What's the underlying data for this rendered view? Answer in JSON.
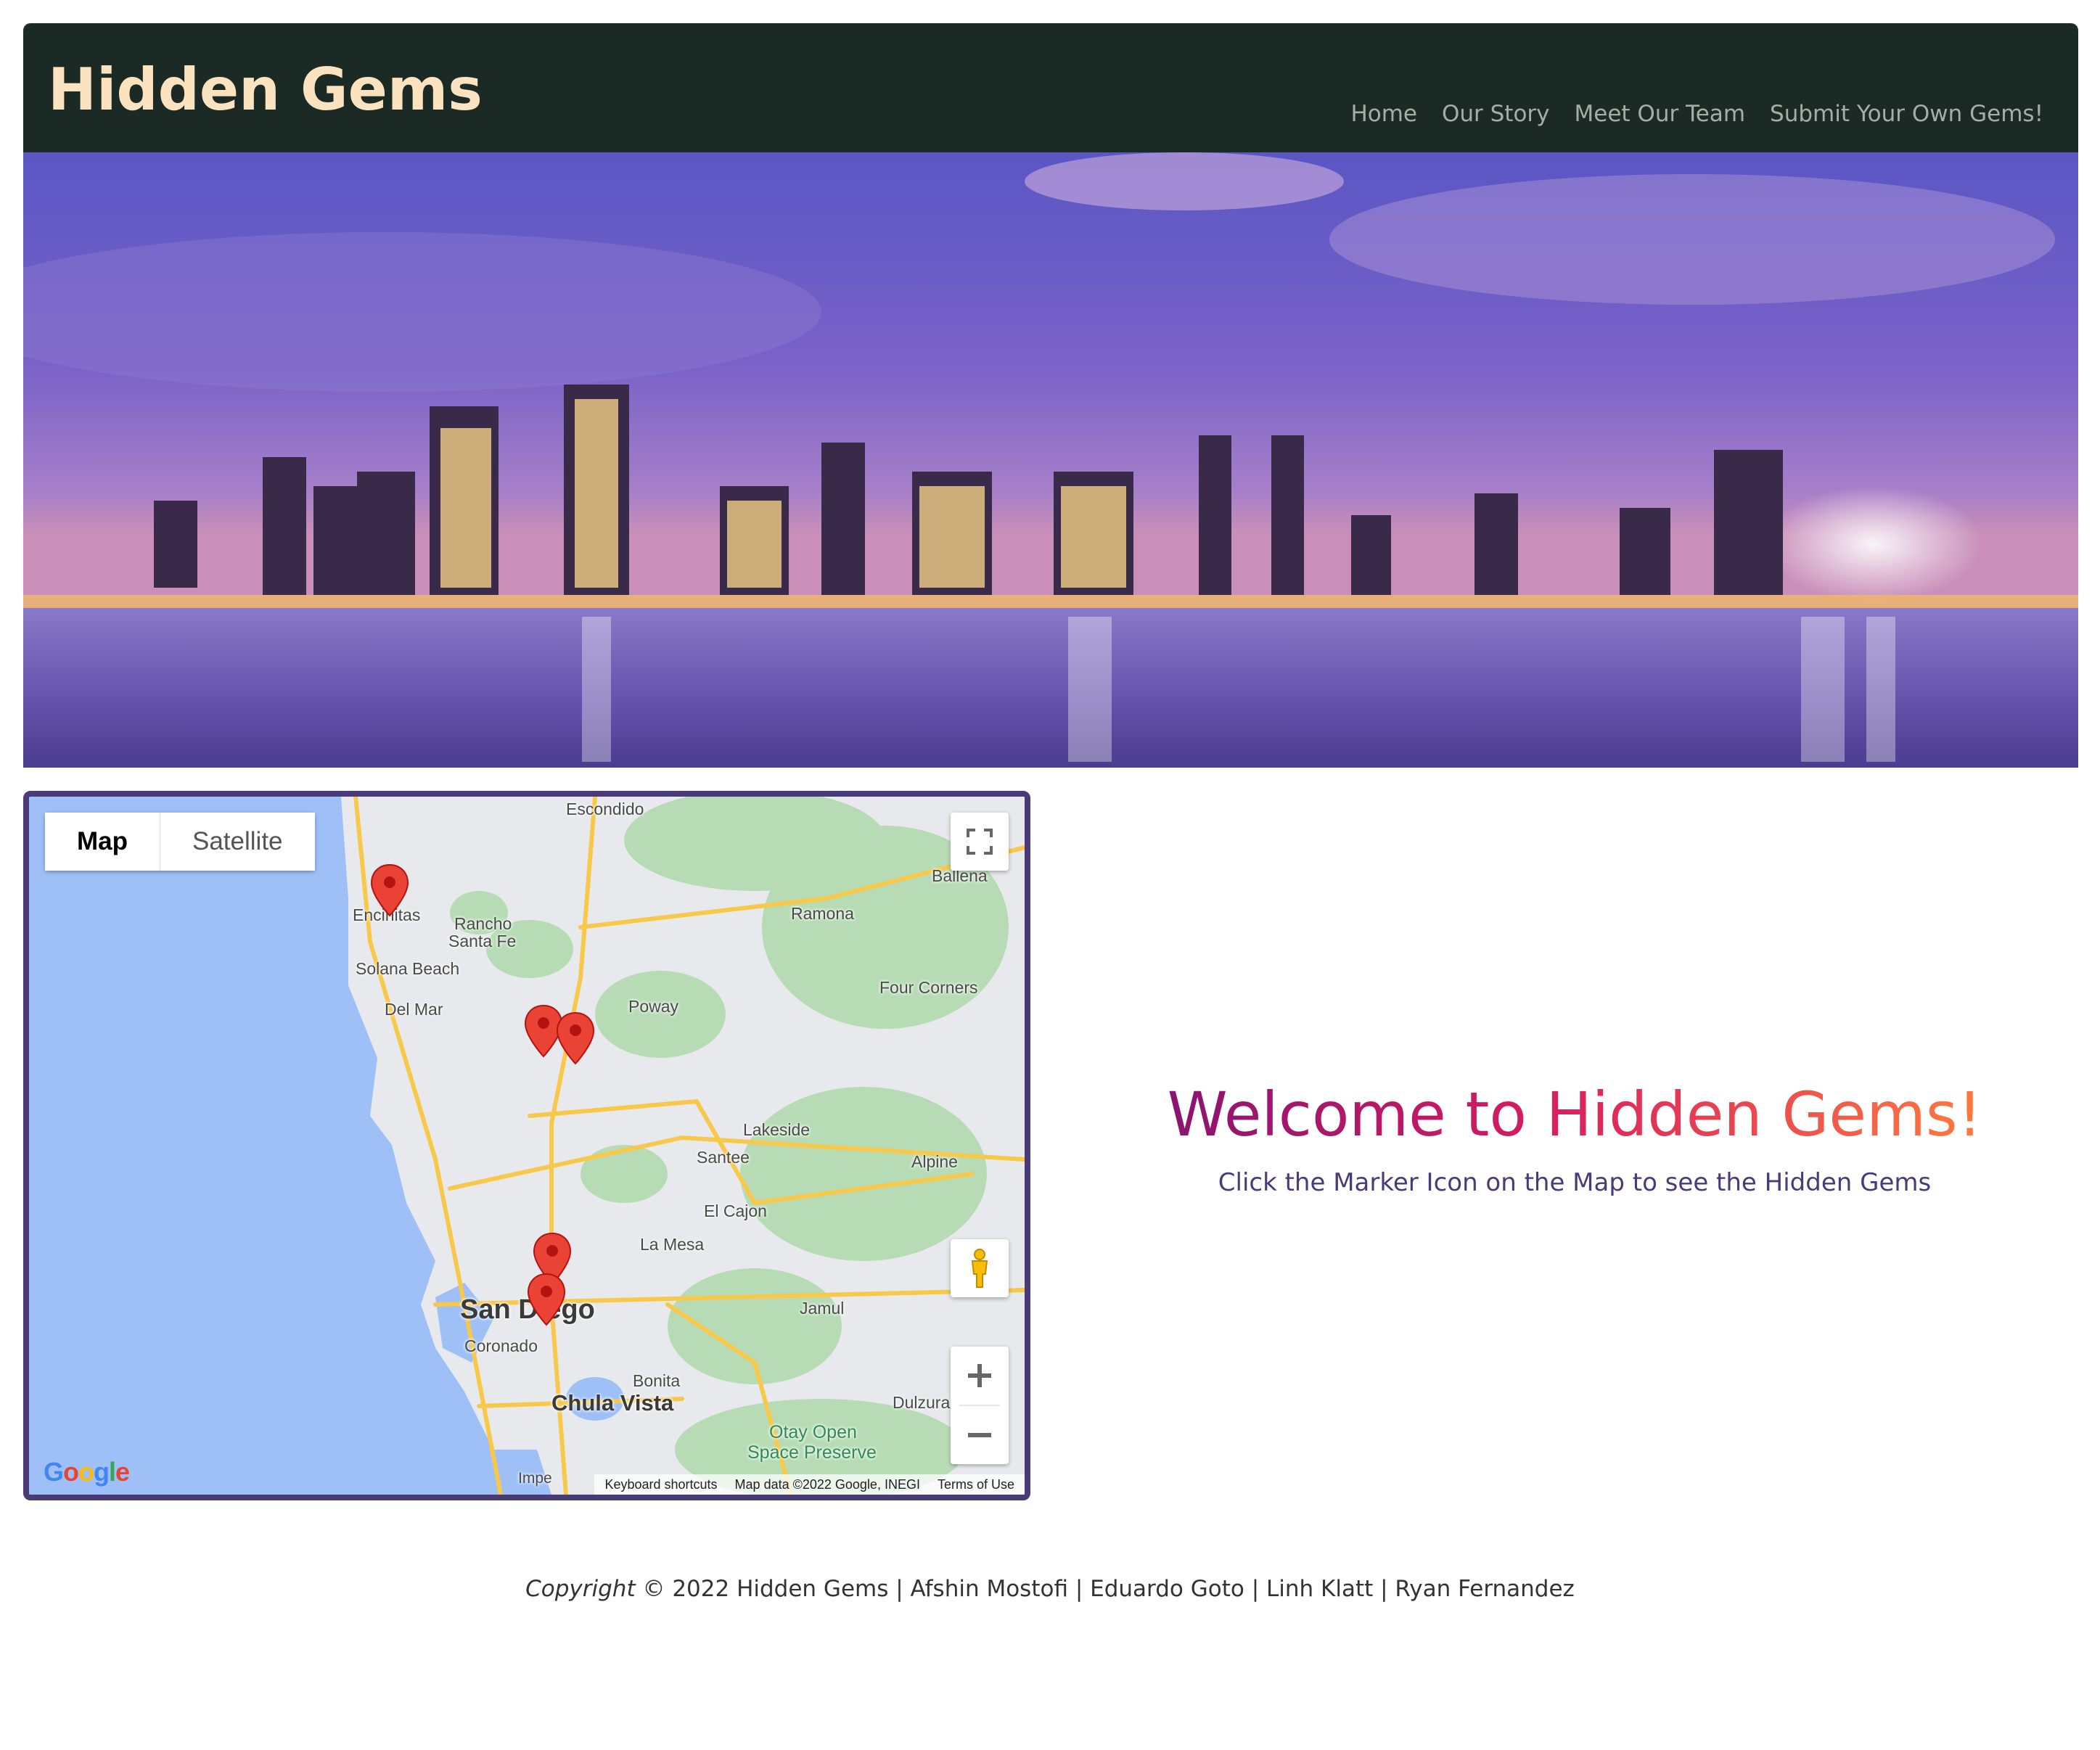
{
  "navbar": {
    "brand": "Hidden Gems",
    "links": [
      "Home",
      "Our Story",
      "Meet Our Team",
      "Submit Your Own Gems!"
    ]
  },
  "hero": {
    "image_description_icon": "san-diego-skyline-photo"
  },
  "map": {
    "type_buttons": [
      "Map",
      "Satellite"
    ],
    "active_type": "Map",
    "labels": {
      "escondido": "Escondido",
      "encinitas": "Encinitas",
      "rancho": "Rancho",
      "santa_fe": "Santa Fe",
      "solana_beach": "Solana Beach",
      "del_mar": "Del Mar",
      "poway": "Poway",
      "ramona": "Ramona",
      "ballena": "Ballena",
      "four_corners": "Four Corners",
      "lakeside": "Lakeside",
      "santee": "Santee",
      "alpine": "Alpine",
      "el_cajon": "El Cajon",
      "la_mesa": "La Mesa",
      "jamul": "Jamul",
      "san_diego": "San Diego",
      "coronado": "Coronado",
      "bonita": "Bonita",
      "chula_vista": "Chula Vista",
      "dulzura": "Dulzura",
      "otay_open": "Otay Open",
      "space_preserve": "Space Preserve",
      "imperial": "Impe"
    },
    "google_logo": "Google",
    "attribution": {
      "shortcuts": "Keyboard shortcuts",
      "map_data": "Map data ©2022 Google, INEGI",
      "terms": "Terms of Use"
    },
    "icons": [
      "fullscreen-icon",
      "pegman-icon",
      "zoom-in-icon",
      "zoom-out-icon",
      "map-marker-icon"
    ]
  },
  "welcome": {
    "title": "Welcome to Hidden Gems!",
    "subtitle": "Click the Marker Icon on the Map to see the Hidden Gems"
  },
  "footer": {
    "copyright_word": "Copyright",
    "text": " © 2022 Hidden Gems | Afshin Mostofi | Eduardo Goto | Linh Klatt | Ryan Fernandez"
  },
  "colors": {
    "navbar_bg": "#1b2a24",
    "brand": "#fbe3c0",
    "nav_link": "#a8aca9",
    "map_border": "#4a3a78",
    "gradient_start": "#8a1470",
    "gradient_mid": "#d81b60",
    "gradient_end": "#ff7a3d"
  }
}
